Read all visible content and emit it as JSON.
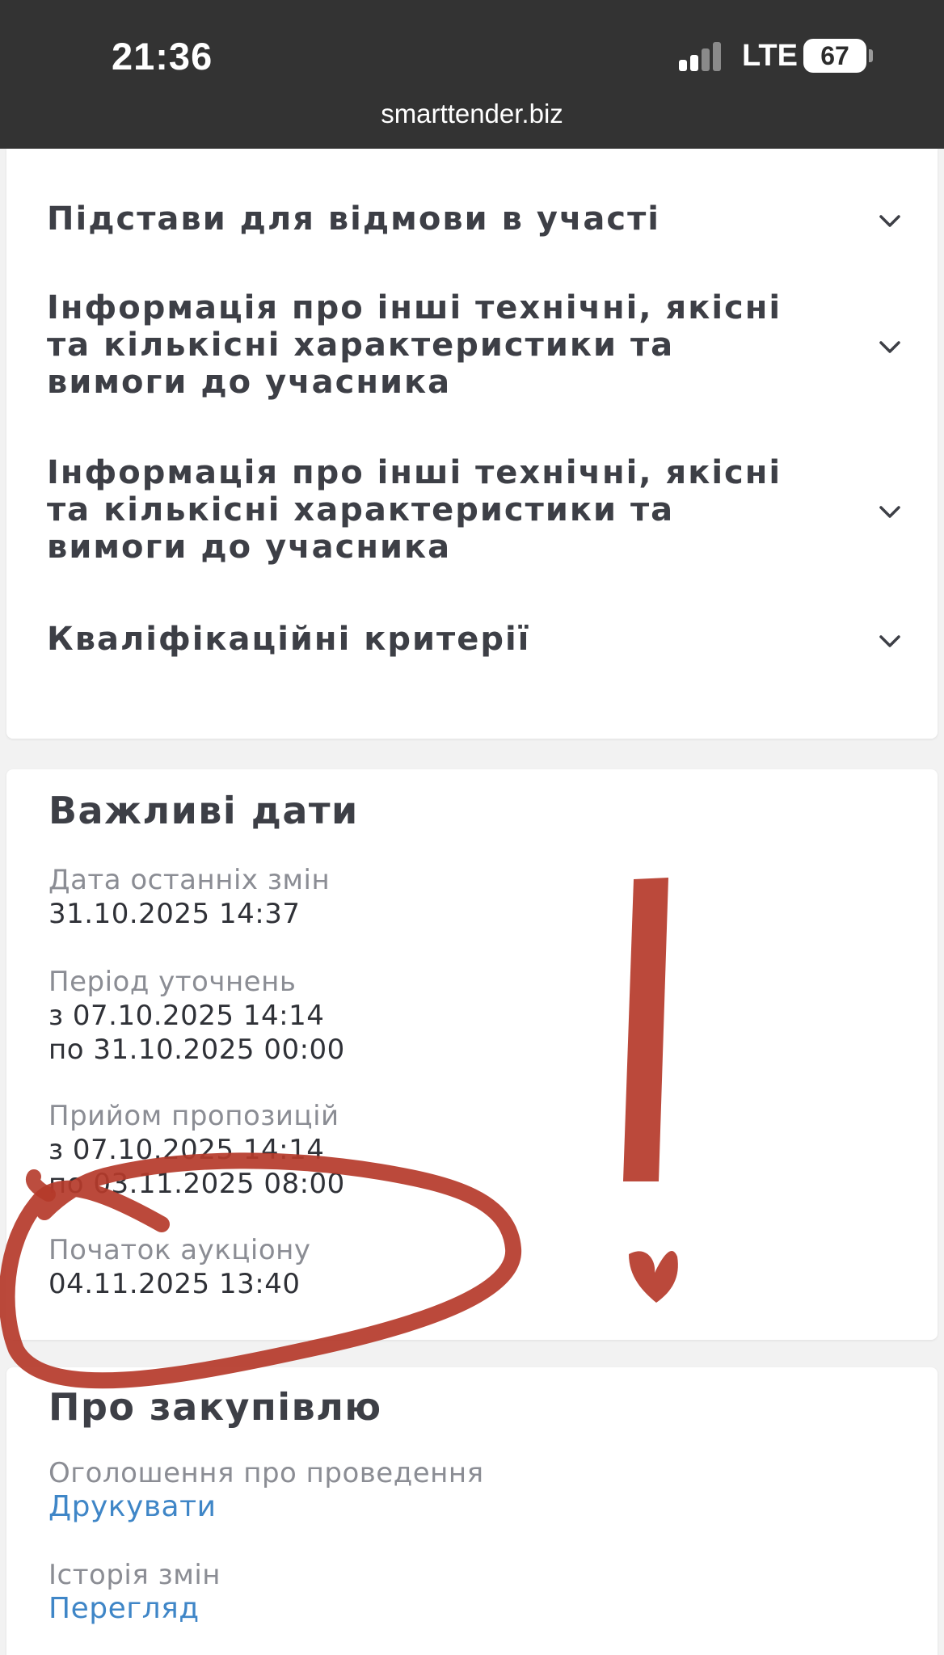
{
  "status_bar": {
    "time": "21:36",
    "network": "LTE",
    "battery": "67"
  },
  "browser": {
    "url": "smarttender.biz"
  },
  "accordion": {
    "items": [
      {
        "label": "Підстави для відмови в участі",
        "icon": "chevron-down-icon"
      },
      {
        "label": "Інформація про інші технічні, якісні та кількісні характеристики та вимоги до учасника",
        "icon": "chevron-down-icon"
      },
      {
        "label": "Інформація про інші технічні, якісні та кількісні характеристики та вимоги до учасника",
        "icon": "chevron-down-icon"
      },
      {
        "label": "Кваліфікаційні критерії",
        "icon": "chevron-down-icon"
      }
    ]
  },
  "important_dates": {
    "title": "Важливі дати",
    "last_change": {
      "label": "Дата останніх змін",
      "value": "31.10.2025 14:37"
    },
    "clarification": {
      "label": "Період уточнень",
      "from": "з 07.10.2025 14:14",
      "to": "по 31.10.2025 00:00"
    },
    "proposals": {
      "label": "Прийом пропозицій",
      "from": "з 07.10.2025 14:14",
      "to": "по 03.11.2025 08:00"
    },
    "auction_start": {
      "label": "Початок аукціону",
      "value": "04.11.2025 13:40"
    }
  },
  "about": {
    "title": "Про закупівлю",
    "announcement": {
      "label": "Оголошення про проведення",
      "link": "Друкувати"
    },
    "history": {
      "label": "Історія змін",
      "link": "Перегляд"
    }
  },
  "colors": {
    "status_bar": "#333333",
    "link": "#3f86c7",
    "annotation": "#b53a2a"
  }
}
